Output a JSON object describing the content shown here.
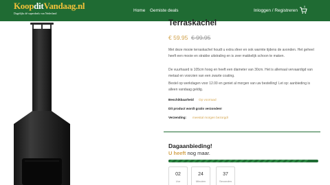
{
  "header": {
    "logo": {
      "title_part1": "Koop",
      "title_part2": "dit",
      "title_part3": "Vandaag.nl",
      "tagline": "Dagelijks dé superdeals van Nederland"
    },
    "nav": {
      "home": "Home",
      "deals": "Gemiste deals"
    },
    "account": "Inloggen / Registreren",
    "cart_count": "0",
    "colors": {
      "bar": "#1f6b33",
      "accent": "#f2c23a"
    }
  },
  "product": {
    "title": "Terraskachel",
    "price_new": "€ 59.95",
    "price_old": "€ 99.95",
    "description": [
      "Met deze mooie terraskachel houdt u extra sfeer en ook warmte tijdens de avonden. Het geheel heeft een mooie en strakke uitstraling en is zeer makkelijk schoon te maken.",
      "De vuurhaard is 105cm hoog en heeft een diameter van 30cm. Het is allemaal vervaardigd van metaal en voorzien van een zwarte coating.",
      "Bestel op werkdagen voor 12.00 en geniet al morgen van uw bestelling! Let op: aanbieding is alleen vandaag geldig."
    ],
    "availability_label": "Beschikbaarheid",
    "availability_value": "Op voorraad",
    "shipping_free": "Dit product wordt gratis verzonden!",
    "shipping_label": "Verzending:",
    "shipping_value": "meestal morgen bezorgd!",
    "image_icon": "patio-heater-image",
    "colors": {
      "price": "#d2a24c",
      "old_price": "#9a9a9a"
    }
  },
  "deal": {
    "title": "Dagaanbieding!",
    "subtitle_highlight": "U heeft",
    "subtitle_rest": " nog maar.",
    "progress_fraction": 0.93,
    "countdown": [
      {
        "value": "02",
        "unit": "Uur"
      },
      {
        "value": "24",
        "unit": "Minuten"
      },
      {
        "value": "37",
        "unit": "Seconden"
      }
    ]
  }
}
